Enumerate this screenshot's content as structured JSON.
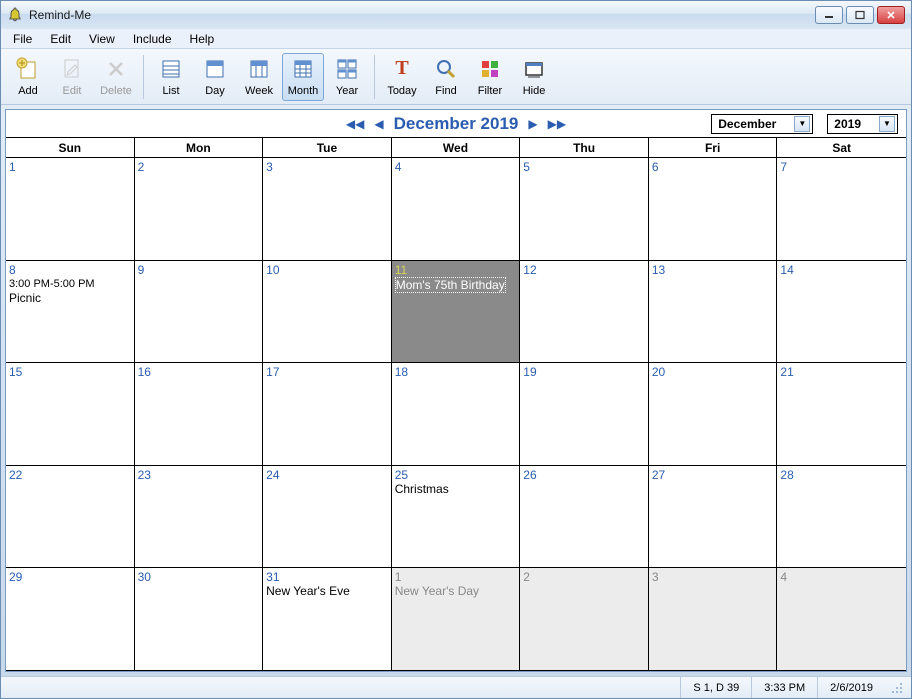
{
  "window": {
    "title": "Remind-Me"
  },
  "menu": {
    "items": [
      "File",
      "Edit",
      "View",
      "Include",
      "Help"
    ]
  },
  "toolbar": {
    "add": "Add",
    "edit": "Edit",
    "delete": "Delete",
    "list": "List",
    "day": "Day",
    "week": "Week",
    "month": "Month",
    "year": "Year",
    "today": "Today",
    "find": "Find",
    "filter": "Filter",
    "hide": "Hide"
  },
  "nav": {
    "title": "December 2019",
    "month_select": "December",
    "year_select": "2019"
  },
  "day_headers": [
    "Sun",
    "Mon",
    "Tue",
    "Wed",
    "Thu",
    "Fri",
    "Sat"
  ],
  "cells": [
    {
      "n": "1"
    },
    {
      "n": "2"
    },
    {
      "n": "3"
    },
    {
      "n": "4"
    },
    {
      "n": "5"
    },
    {
      "n": "6"
    },
    {
      "n": "7"
    },
    {
      "n": "8",
      "time": "3:00 PM-5:00 PM",
      "ev": "Picnic"
    },
    {
      "n": "9"
    },
    {
      "n": "10"
    },
    {
      "n": "11",
      "ev": "Mom's 75th Birthday",
      "sel": true
    },
    {
      "n": "12"
    },
    {
      "n": "13"
    },
    {
      "n": "14"
    },
    {
      "n": "15"
    },
    {
      "n": "16"
    },
    {
      "n": "17"
    },
    {
      "n": "18"
    },
    {
      "n": "19"
    },
    {
      "n": "20"
    },
    {
      "n": "21"
    },
    {
      "n": "22"
    },
    {
      "n": "23"
    },
    {
      "n": "24"
    },
    {
      "n": "25",
      "ev": "Christmas"
    },
    {
      "n": "26"
    },
    {
      "n": "27"
    },
    {
      "n": "28"
    },
    {
      "n": "29"
    },
    {
      "n": "30"
    },
    {
      "n": "31",
      "ev": "New Year's Eve"
    },
    {
      "n": "1",
      "other": true,
      "ev": "New Year's Day"
    },
    {
      "n": "2",
      "other": true
    },
    {
      "n": "3",
      "other": true
    },
    {
      "n": "4",
      "other": true
    }
  ],
  "status": {
    "s1": "S 1, D 39",
    "time": "3:33 PM",
    "date": "2/6/2019"
  }
}
